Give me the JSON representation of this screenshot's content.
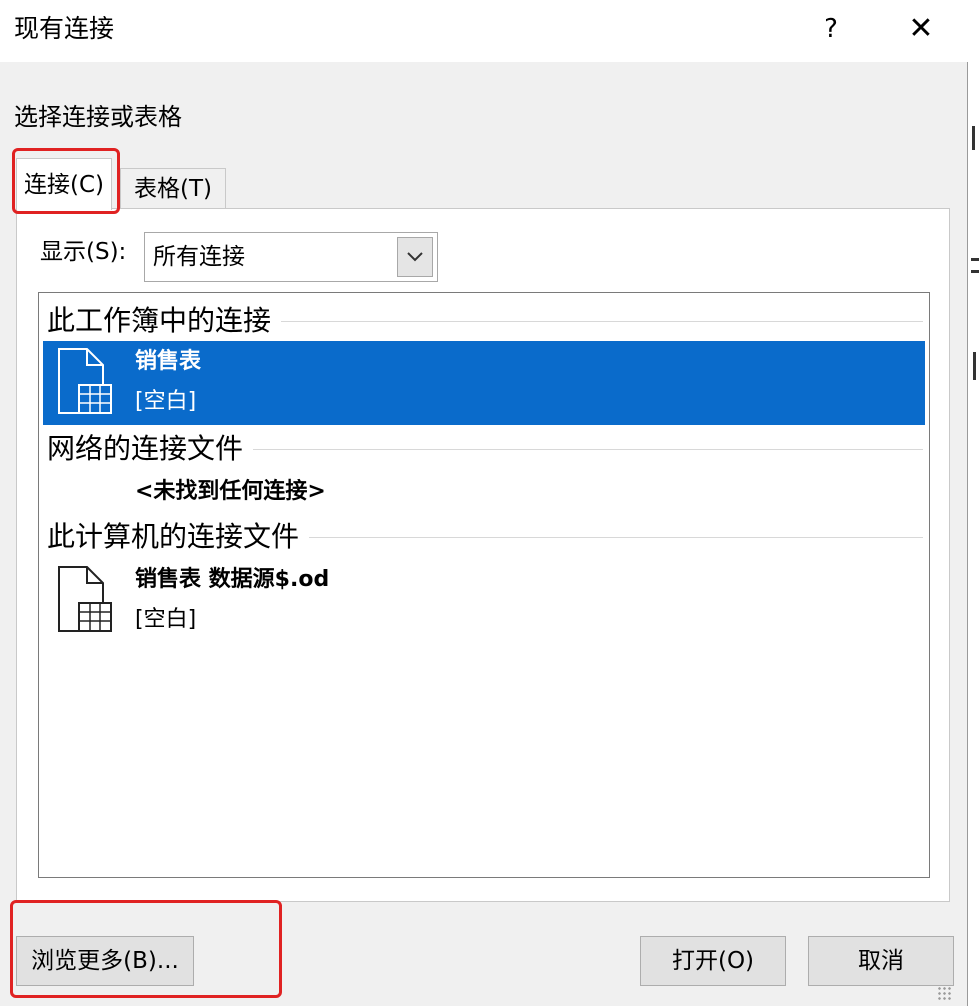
{
  "window": {
    "title": "现有连接",
    "help_label": "?",
    "close_label": "✕"
  },
  "section_label": "选择连接或表格",
  "tabs": [
    {
      "label": "连接(C)",
      "active": true
    },
    {
      "label": "表格(T)",
      "active": false
    }
  ],
  "show": {
    "label": "显示(S):",
    "value": "所有连接"
  },
  "groups": [
    {
      "header": "此工作簿中的连接",
      "items": [
        {
          "name": "销售表",
          "description": "[空白]",
          "icon": "connection-file-icon",
          "selected": true
        }
      ]
    },
    {
      "header": "网络的连接文件",
      "empty_message": "<未找到任何连接>"
    },
    {
      "header": "此计算机的连接文件",
      "items": [
        {
          "name": "销售表 数据源$.od",
          "description": "[空白]",
          "icon": "connection-file-icon",
          "selected": false
        }
      ]
    }
  ],
  "buttons": {
    "browse": "浏览更多(B)...",
    "open": "打开(O)",
    "cancel": "取消"
  },
  "colors": {
    "selection": "#0a6bcb",
    "highlight_box": "#e02222",
    "dialog_bg": "#f0f0f0"
  }
}
